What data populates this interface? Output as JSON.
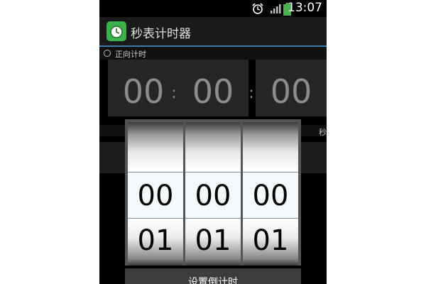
{
  "statusbar": {
    "time": "13:07",
    "icons": [
      "alarm-clock-icon",
      "signal-icon",
      "battery-icon"
    ]
  },
  "app": {
    "title": "秒表计时器",
    "icon": "alarm-clock-app-icon"
  },
  "mode": {
    "label": "正向计时"
  },
  "display": {
    "hours": "00",
    "minutes": "00",
    "seconds": "00",
    "separator": ":",
    "unit_label": "秒"
  },
  "picker": {
    "wheels": [
      {
        "selected": "00",
        "next": "01"
      },
      {
        "selected": "00",
        "next": "01"
      },
      {
        "selected": "00",
        "next": "01"
      }
    ],
    "button_label": "设置倒计时"
  },
  "colors": {
    "accent_line": "#3d7ea6",
    "app_icon": "#3bb24b",
    "battery": "#4caf50"
  }
}
